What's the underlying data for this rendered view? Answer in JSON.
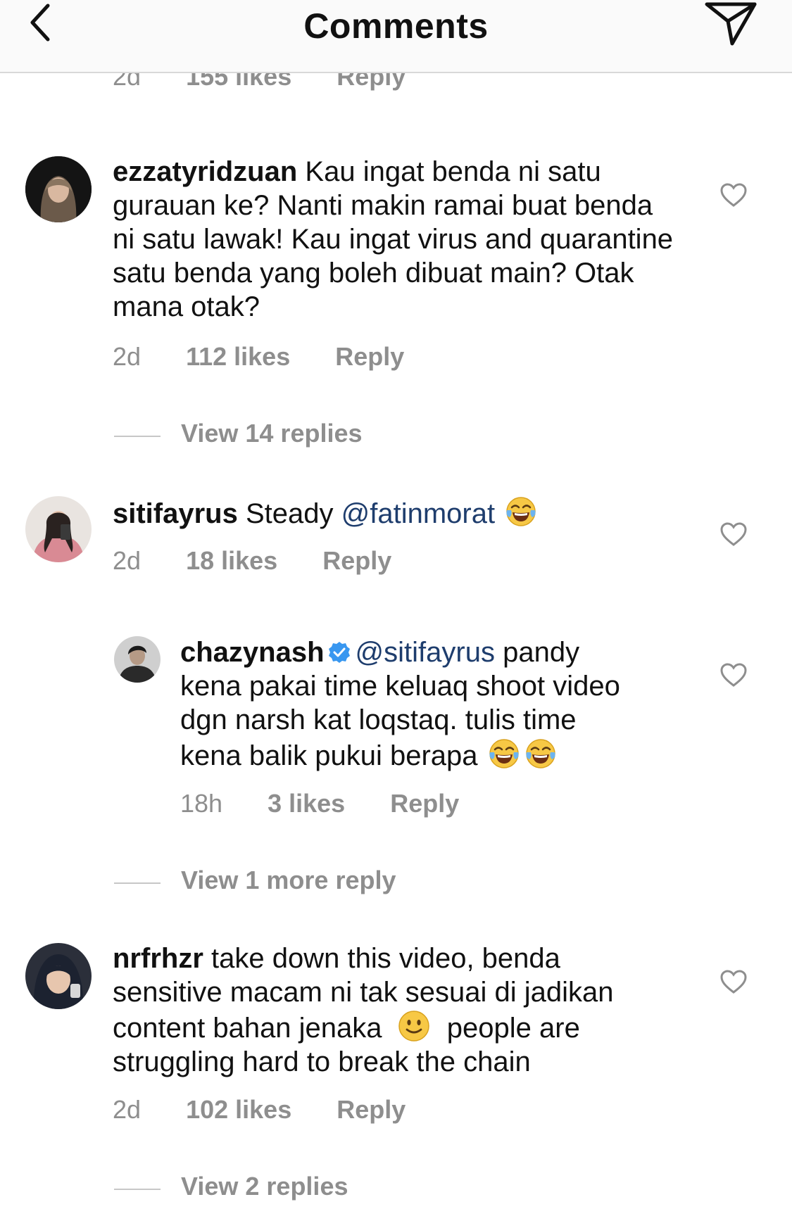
{
  "header": {
    "title": "Comments"
  },
  "partial": {
    "time": "2d",
    "likes": "155 likes",
    "reply": "Reply"
  },
  "comments": [
    {
      "user": "ezzatyridzuan",
      "text": "Kau ingat benda ni satu gurauan ke? Nanti makin ramai buat benda ni satu lawak!  Kau ingat virus and quarantine satu benda yang boleh dibuat main? Otak mana otak?",
      "time": "2d",
      "likes": "112 likes",
      "reply": "Reply",
      "view_replies": "View 14 replies"
    },
    {
      "user": "sitifayrus",
      "text": "Steady",
      "mention": "@fatinmorat",
      "time": "2d",
      "likes": "18 likes",
      "reply": "Reply"
    },
    {
      "user": "chazynash",
      "mention": "@sitifayrus",
      "text_line1": "pandy",
      "text_line2": "kena pakai time keluaq shoot video",
      "text_line3": "dgn narsh kat loqstaq. tulis time",
      "text_line4": "kena balik pukui berapa",
      "time": "18h",
      "likes": "3 likes",
      "reply": "Reply",
      "view_replies": "View 1 more reply"
    },
    {
      "user": "nrfrhzr",
      "text_line1": "take down this video, benda",
      "text_line2": "sensitive macam ni tak sesuai di jadikan",
      "text_line3a": "content bahan jenaka",
      "text_line3b": "people are",
      "text_line4": "struggling hard to break the chain",
      "time": "2d",
      "likes": "102 likes",
      "reply": "Reply",
      "view_replies": "View 2 replies"
    }
  ],
  "icons": {
    "back": "chevron-left-icon",
    "send": "paper-plane-icon",
    "like": "heart-outline-icon",
    "verified": "verified-badge-icon",
    "laugh": "tears-of-joy-emoji",
    "smile": "slightly-smiling-emoji"
  },
  "colors": {
    "mention": "#1e3d6d",
    "meta": "#8e8e8e",
    "verified": "#3897f0"
  }
}
